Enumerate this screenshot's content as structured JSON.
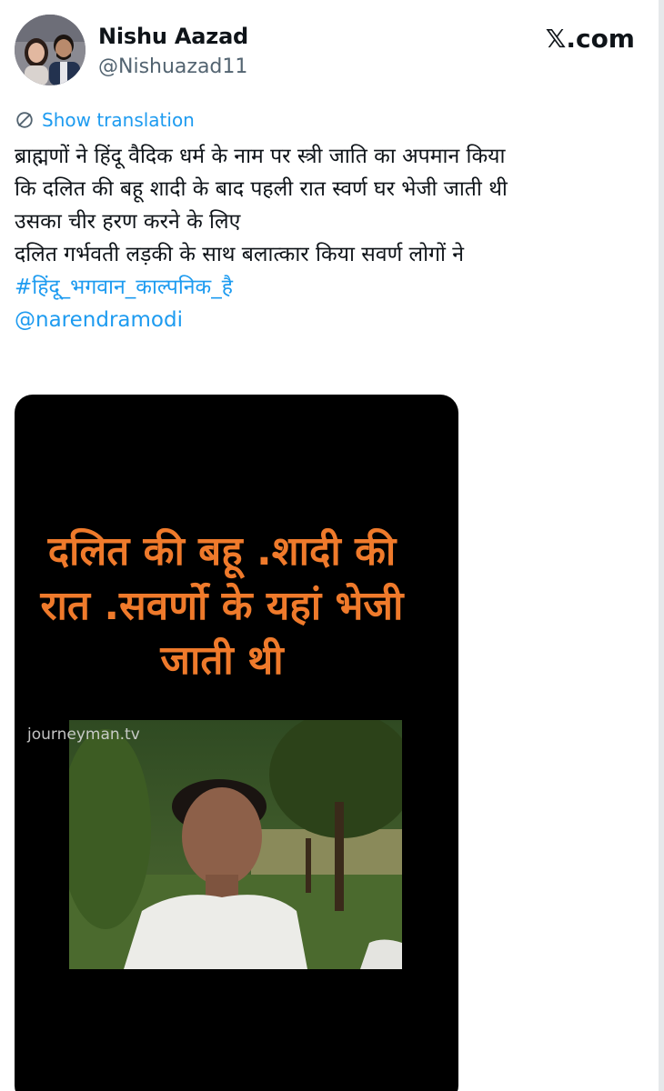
{
  "tweet": {
    "author_name": "Nishu Aazad",
    "author_handle": "@Nishuazad11",
    "site_logo": "𝕏.com",
    "show_translation_label": "Show translation",
    "translation_icon": "globe-icon",
    "text_lines": [
      "ब्राह्मणों ने हिंदू वैदिक धर्म के नाम पर स्त्री जाति का अपमान किया",
      "कि दलित की बहू शादी के बाद पहली रात स्वर्ण घर भेजी जाती थी",
      "उसका चीर हरण करने के लिए",
      "दलित गर्भवती लड़की के साथ बलात्कार किया सवर्ण लोगों ने"
    ],
    "hashtag": "#हिंदू_भगवान_काल्पनिक_है",
    "mention": "@narendramodi"
  },
  "media": {
    "overlay_lines": [
      "दलित की बहू .शादी की",
      "रात .सवर्णो के यहां भेजी",
      "जाती थी"
    ],
    "watermark": "journeyman.tv"
  },
  "colors": {
    "link": "#1d9bf0",
    "overlay_text": "#ef7a2b",
    "muted": "#536471"
  }
}
